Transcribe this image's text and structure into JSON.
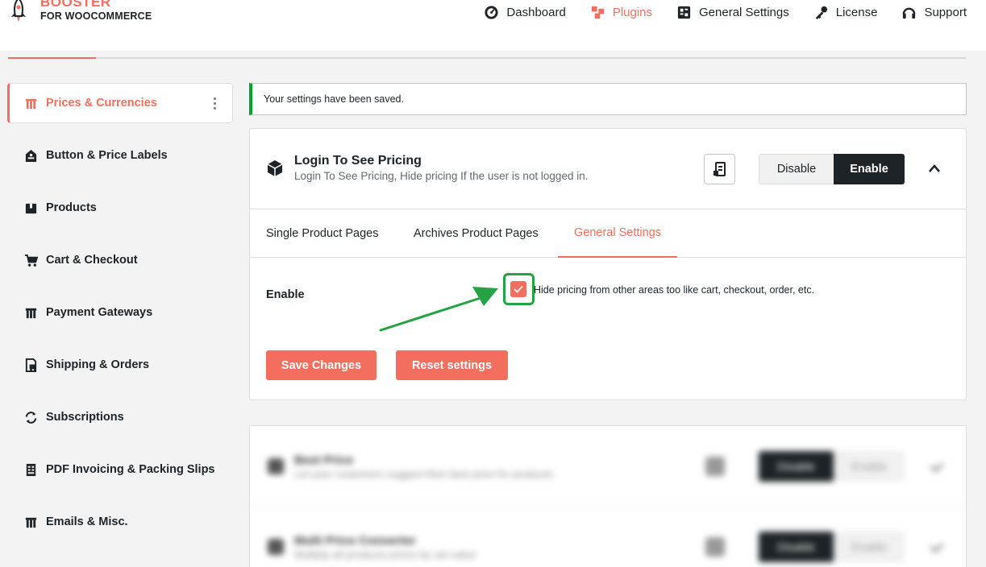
{
  "brand": {
    "name": "BOOSTER",
    "sub": "FOR WOOCOMMERCE",
    "accent": "#f46e5e"
  },
  "topnav": [
    {
      "label": "Dashboard",
      "icon": "dashboard-gauge-icon"
    },
    {
      "label": "Plugins",
      "icon": "plugins-cubes-icon",
      "active": true
    },
    {
      "label": "General Settings",
      "icon": "settings-grid-icon"
    },
    {
      "label": "License",
      "icon": "key-icon"
    },
    {
      "label": "Support",
      "icon": "headset-icon"
    }
  ],
  "sidebar": {
    "items": [
      {
        "label": "Prices & Currencies",
        "icon": "price-tag-icon",
        "active": true
      },
      {
        "label": "Button & Price Labels",
        "icon": "label-icon"
      },
      {
        "label": "Products",
        "icon": "box-icon"
      },
      {
        "label": "Cart & Checkout",
        "icon": "cart-icon"
      },
      {
        "label": "Payment Gateways",
        "icon": "payment-icon"
      },
      {
        "label": "Shipping & Orders",
        "icon": "shipping-icon"
      },
      {
        "label": "Subscriptions",
        "icon": "refresh-icon"
      },
      {
        "label": "PDF Invoicing & Packing Slips",
        "icon": "invoice-icon"
      },
      {
        "label": "Emails & Misc.",
        "icon": "email-icon"
      }
    ]
  },
  "notice": {
    "text": "Your settings have been saved.",
    "color": "#00a32a"
  },
  "module": {
    "title": "Login To See Pricing",
    "description": "Login To See Pricing, Hide pricing If the user is not logged in.",
    "disable_label": "Disable",
    "enable_label": "Enable",
    "state": "enabled"
  },
  "tabs": [
    {
      "label": "Single Product Pages"
    },
    {
      "label": "Archives Product Pages"
    },
    {
      "label": "General Settings",
      "active": true
    }
  ],
  "settings": {
    "enable_label": "Enable",
    "checkbox_checked": true,
    "checkbox_text": "Hide pricing from other areas too like cart, checkout, order, etc."
  },
  "actions": {
    "save_label": "Save Changes",
    "reset_label": "Reset settings"
  },
  "blurred_modules": [
    {
      "title": "Best Price",
      "description": "Let your customers suggest their best price for products",
      "disable_label": "Disable",
      "enable_label": "Enable"
    },
    {
      "title": "Multi Price Converter",
      "description": "Multiply all products prices by set value",
      "disable_label": "Disable",
      "enable_label": "Enable"
    }
  ]
}
